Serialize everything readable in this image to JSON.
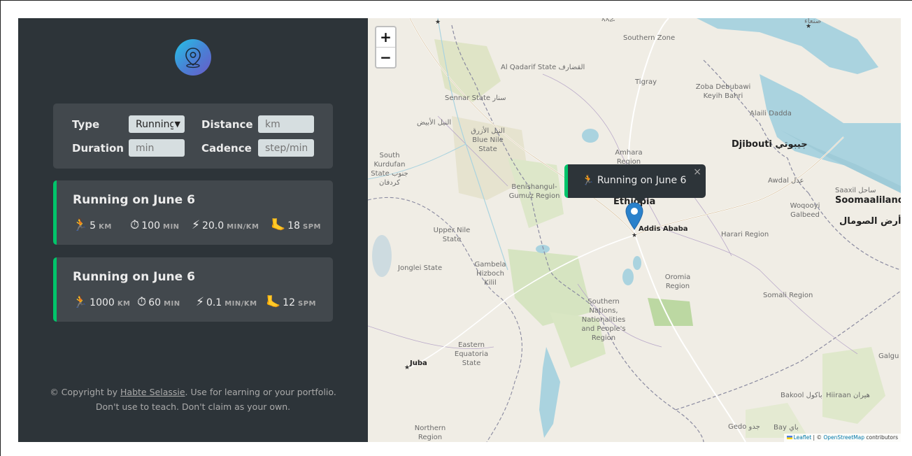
{
  "sidebar": {
    "form": {
      "type_label": "Type",
      "type_value": "Running",
      "distance_label": "Distance",
      "distance_placeholder": "km",
      "duration_label": "Duration",
      "duration_placeholder": "min",
      "cadence_label": "Cadence",
      "cadence_placeholder": "step/min"
    },
    "workouts": [
      {
        "title": "Running on June 6",
        "distance": "5",
        "distance_unit": "KM",
        "duration": "100",
        "duration_unit": "MIN",
        "pace": "20.0",
        "pace_unit": "MIN/KM",
        "cadence": "18",
        "cadence_unit": "SPM"
      },
      {
        "title": "Running on June 6",
        "distance": "1000",
        "distance_unit": "KM",
        "duration": "60",
        "duration_unit": "MIN",
        "pace": "0.1",
        "pace_unit": "MIN/KM",
        "cadence": "12",
        "cadence_unit": "SPM"
      }
    ],
    "copyright": {
      "prefix": "© Copyright by ",
      "author": "Habte Selassie",
      "suffix": ". Use for learning or your portfolio.",
      "line2": "Don't use to teach. Don't claim as your own."
    }
  },
  "icons": {
    "runner": "🏃",
    "stopwatch": "⏱",
    "bolt": "⚡",
    "foot": "🦶"
  },
  "map": {
    "zoom_in": "+",
    "zoom_out": "−",
    "popup_text": "🏃 Running on June 6",
    "popup_close": "×",
    "attribution_leaflet": "Leaflet",
    "attribution_sep": " | © ",
    "attribution_osm": "OpenStreetMap",
    "attribution_tail": " contributors",
    "labels": {
      "ethiopia": "Ethiopia",
      "addis": "Addis Ababa",
      "djibouti": "Djibouti جيبوتي",
      "soomaaliland": "Soomaaliland",
      "ard_somal": "أرض الصومال",
      "amhara": "Amhara Region",
      "tigray": "Tigray",
      "oromia": "Oromia Region",
      "somali_region": "Somali Region",
      "harari": "Harari Region",
      "benishangul": "Benishangul-Gumuz Region",
      "gambela": "Gambela Hizboch Kilil",
      "snnpr": "Southern Nations, Nationalities and People's Region",
      "upper_nile": "Upper Nile State",
      "jonglei": "Jonglei State",
      "eastern_equatoria": "Eastern Equatoria State",
      "juba": "Juba",
      "al_qadarif": "Al Qadarif State القضارف",
      "sennar": "Sennar State سنار",
      "blue_nile": "النيل الأزرق Blue Nile State",
      "white_nile": "النيل الأبيض",
      "south_kordofan": "South Kurdufan State جنوب كردفان",
      "zoba": "Zoba Debubawi Keyih Bahri",
      "afar_north": "Southern Zone",
      "sanaa": "صنعاء",
      "alaili": "Alaili Dadda",
      "awdal": "Awdal عدل",
      "woqooyi": "Woqooyi Galbeed",
      "saaxil": "Saaxil ساحل",
      "bakool": "Bakool باكول",
      "hiiraan": "Hiiraan هيران",
      "gedo": "Gedo جدو",
      "bay": "Bay باي",
      "galgu": "Galgu",
      "northern": "Northern Region"
    }
  }
}
